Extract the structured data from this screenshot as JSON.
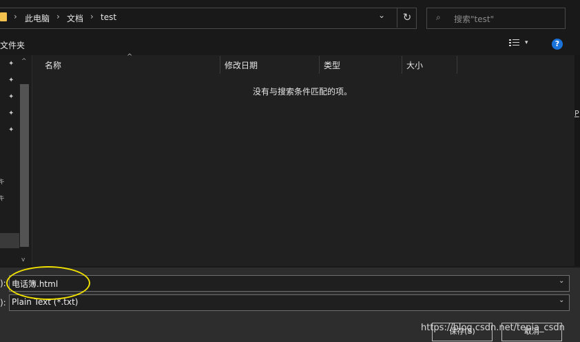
{
  "address": {
    "crumbs": [
      "此电脑",
      "文档",
      "test"
    ],
    "sep": "›",
    "dropdown_glyph": "⌄",
    "refresh_glyph": "↻"
  },
  "search": {
    "placeholder": "搜索\"test\"",
    "icon_glyph": "⌕"
  },
  "toolbar": {
    "new_folder_label": "文件夹",
    "view_dropdown_glyph": "▾",
    "help_glyph": "?"
  },
  "nav": {
    "pin_glyph": "📌",
    "pins": 5,
    "scroll_up_glyph": "^",
    "scroll_down_glyph": "v",
    "glyphs": [
      "キ",
      "キ"
    ]
  },
  "list": {
    "columns": [
      "名称",
      "修改日期",
      "类型",
      "大小"
    ],
    "sort_glyph": "^",
    "empty_message": "没有与搜索条件匹配的项。"
  },
  "right_edge_label": "P",
  "form": {
    "filename_label": "):",
    "filename_value": "电话簿.html",
    "filetype_label": "):",
    "filetype_value": "Plain Text (*.txt)",
    "arrow_glyph": "⌄"
  },
  "buttons": {
    "save": "保存(S)",
    "cancel": "取消"
  },
  "watermark": "https://blog.csdn.net/tepia_csdn",
  "colors": {
    "highlight": "#f0e000",
    "help": "#1a73d9",
    "folder": "#f2c14e"
  }
}
